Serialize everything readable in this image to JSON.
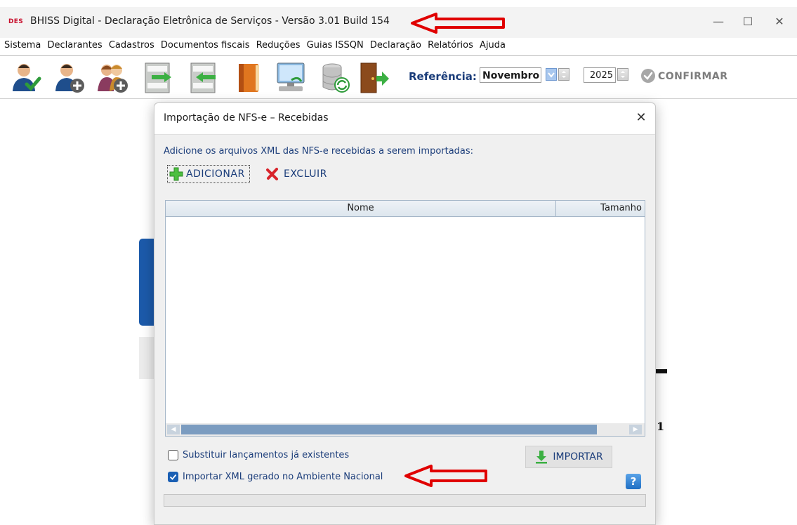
{
  "window": {
    "logo_text": "DES",
    "title": "BHISS Digital - Declaração Eletrônica de Serviços - Versão 3.01 Build 154",
    "minimize_glyph": "—",
    "maximize_glyph": "☐",
    "close_glyph": "✕"
  },
  "menu": [
    "Sistema",
    "Declarantes",
    "Cadastros",
    "Documentos fiscais",
    "Reduções",
    "Guias ISSQN",
    "Declaração",
    "Relatórios",
    "Ajuda"
  ],
  "toolbar": {
    "icons": [
      "user-check-icon",
      "user-add-icon",
      "users-add-icon",
      "document-export-icon",
      "document-import-icon",
      "book-icon",
      "computer-network-icon",
      "database-refresh-icon",
      "exit-door-icon"
    ],
    "reference_label": "Referência:",
    "month": "Novembro",
    "year": "2025",
    "confirm_label": "CONFIRMAR"
  },
  "background": {
    "digit": "1"
  },
  "dialog": {
    "title": "Importação de NFS-e – Recebidas",
    "close_glyph": "✕",
    "instruction": "Adicione os arquivos XML das NFS-e recebidas a serem importadas:",
    "add_label": "ADICIONAR",
    "delete_label": "EXCLUIR",
    "grid": {
      "columns": [
        "Nome",
        "Tamanho"
      ],
      "rows": []
    },
    "options": [
      {
        "label": "Substituir lançamentos já existentes",
        "checked": false
      },
      {
        "label": "Importar XML gerado no Ambiente Nacional",
        "checked": true
      }
    ],
    "import_label": "IMPORTAR",
    "help_glyph": "?",
    "progress": 0
  },
  "colors": {
    "annotation_arrow": "#e00000",
    "accent_blue": "#1b3d7a",
    "grid_border": "#a5b6c8"
  }
}
